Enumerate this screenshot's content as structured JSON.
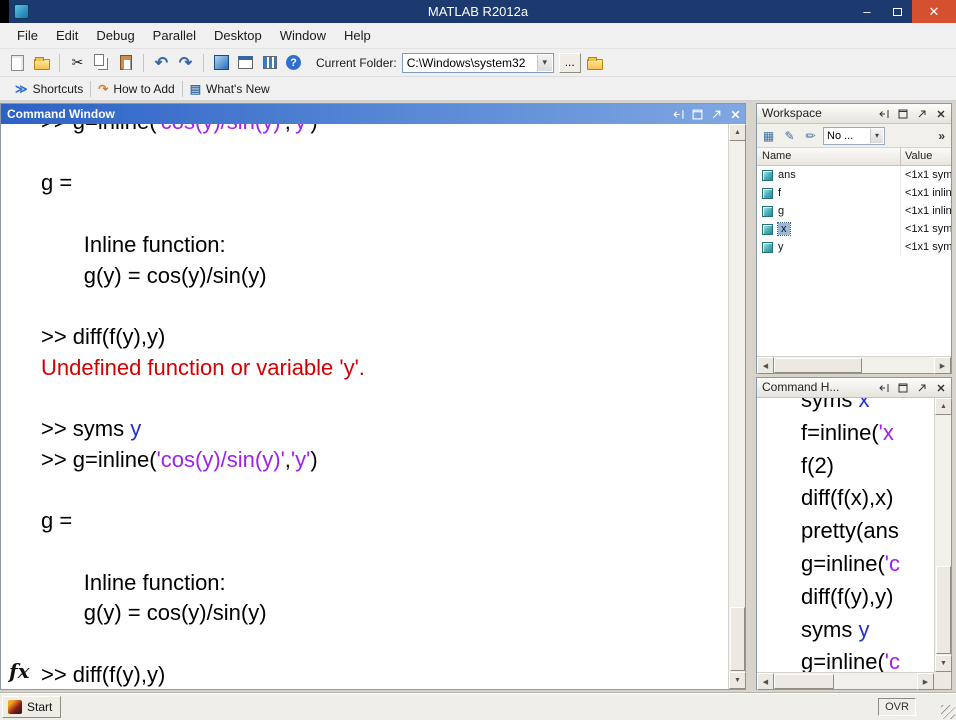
{
  "colors": {
    "titlebar_bg": "#1c3a70",
    "close_button_bg": "#d4502e",
    "cw_title_gradient_left": "#2b62c6",
    "cw_title_gradient_right": "#7fa7e2",
    "text": "#000000",
    "string": "#a020f0",
    "error": "#d40000",
    "keyword": "#2233cc",
    "selection_bg": "#9db8d9"
  },
  "window": {
    "title": "MATLAB R2012a"
  },
  "menu": {
    "items": [
      "File",
      "Edit",
      "Debug",
      "Parallel",
      "Desktop",
      "Window",
      "Help"
    ]
  },
  "toolbar": {
    "current_folder_label": "Current Folder:",
    "current_folder_value": "C:\\Windows\\system32",
    "browse_button_label": "..."
  },
  "shortcuts": {
    "items": [
      {
        "label": "Shortcuts",
        "icon": "shortcuts-icon"
      },
      {
        "label": "How to Add",
        "icon": "how-to-add-icon"
      },
      {
        "label": "What's New",
        "icon": "whats-new-icon"
      }
    ]
  },
  "icons": {
    "minimize-icon": "–",
    "close-icon": "✕",
    "cut-icon": "✂",
    "undo-icon": "↶",
    "redo-icon": "↷",
    "help-icon": "?",
    "combo-arrow-icon": "▾",
    "shortcuts-icon": "≫",
    "how-to-add-icon": "↷",
    "whats-new-icon": "▤",
    "new-variable-icon": "▦",
    "import-data-icon": "✎",
    "plot-brush-icon": "✏",
    "overflow-icon": "»",
    "scroll-up-icon": "▲",
    "scroll-down-icon": "▼",
    "scroll-left-icon": "◀",
    "scroll-right-icon": "▶"
  },
  "command_window": {
    "title": "Command Window",
    "fx_label": "fx",
    "lines": [
      [
        {
          "t": ">> g=inline(",
          "c": "k"
        },
        {
          "t": "'cos(y)/sin(y)'",
          "c": "s"
        },
        {
          "t": ",",
          "c": "k"
        },
        {
          "t": "'y'",
          "c": "s"
        },
        {
          "t": ")",
          "c": "k"
        }
      ],
      [],
      [
        {
          "t": "g =",
          "c": "k"
        }
      ],
      [],
      [
        {
          "t": "       Inline function:",
          "c": "k"
        }
      ],
      [
        {
          "t": "       g(y) = cos(y)/sin(y)",
          "c": "k"
        }
      ],
      [],
      [
        {
          "t": ">> diff(f(y),y)",
          "c": "k"
        }
      ],
      [
        {
          "t": "Undefined function or variable 'y'.",
          "c": "e"
        }
      ],
      [],
      [
        {
          "t": ">> syms ",
          "c": "k"
        },
        {
          "t": "y",
          "c": "b"
        }
      ],
      [
        {
          "t": ">> g=inline(",
          "c": "k"
        },
        {
          "t": "'cos(y)/sin(y)'",
          "c": "s"
        },
        {
          "t": ",",
          "c": "k"
        },
        {
          "t": "'y'",
          "c": "s"
        },
        {
          "t": ")",
          "c": "k"
        }
      ],
      [],
      [
        {
          "t": "g =",
          "c": "k"
        }
      ],
      [],
      [
        {
          "t": "       Inline function:",
          "c": "k"
        }
      ],
      [
        {
          "t": "       g(y) = cos(y)/sin(y)",
          "c": "k"
        }
      ],
      [],
      [
        {
          "t": ">> diff(f(y),y)",
          "c": "k"
        }
      ]
    ]
  },
  "workspace": {
    "title": "Workspace",
    "stack_label": "No ...",
    "columns": [
      "Name",
      "Value"
    ],
    "rows": [
      {
        "name": "ans",
        "value": "<1x1 sym",
        "selected": false
      },
      {
        "name": "f",
        "value": "<1x1 inlin",
        "selected": false
      },
      {
        "name": "g",
        "value": "<1x1 inlin",
        "selected": false
      },
      {
        "name": "x",
        "value": "<1x1 sym",
        "selected": true
      },
      {
        "name": "y",
        "value": "<1x1 sym",
        "selected": false
      }
    ]
  },
  "command_history": {
    "title": "Command H...",
    "lines": [
      [
        {
          "t": "syms ",
          "c": "k"
        },
        {
          "t": "x",
          "c": "b"
        }
      ],
      [
        {
          "t": "f=inline(",
          "c": "k"
        },
        {
          "t": "'x",
          "c": "s"
        }
      ],
      [
        {
          "t": "f(2)",
          "c": "k"
        }
      ],
      [
        {
          "t": "diff(f(x),x)",
          "c": "k"
        }
      ],
      [
        {
          "t": "pretty(ans",
          "c": "k"
        }
      ],
      [
        {
          "t": "g=inline(",
          "c": "k"
        },
        {
          "t": "'c",
          "c": "s"
        }
      ],
      [
        {
          "t": "diff(f(y),y)",
          "c": "k"
        }
      ],
      [
        {
          "t": "syms ",
          "c": "k"
        },
        {
          "t": "y",
          "c": "b"
        }
      ],
      [
        {
          "t": "g=inline(",
          "c": "k"
        },
        {
          "t": "'c",
          "c": "s"
        }
      ]
    ]
  },
  "status_bar": {
    "start_label": "Start",
    "ovr_label": "OVR"
  }
}
